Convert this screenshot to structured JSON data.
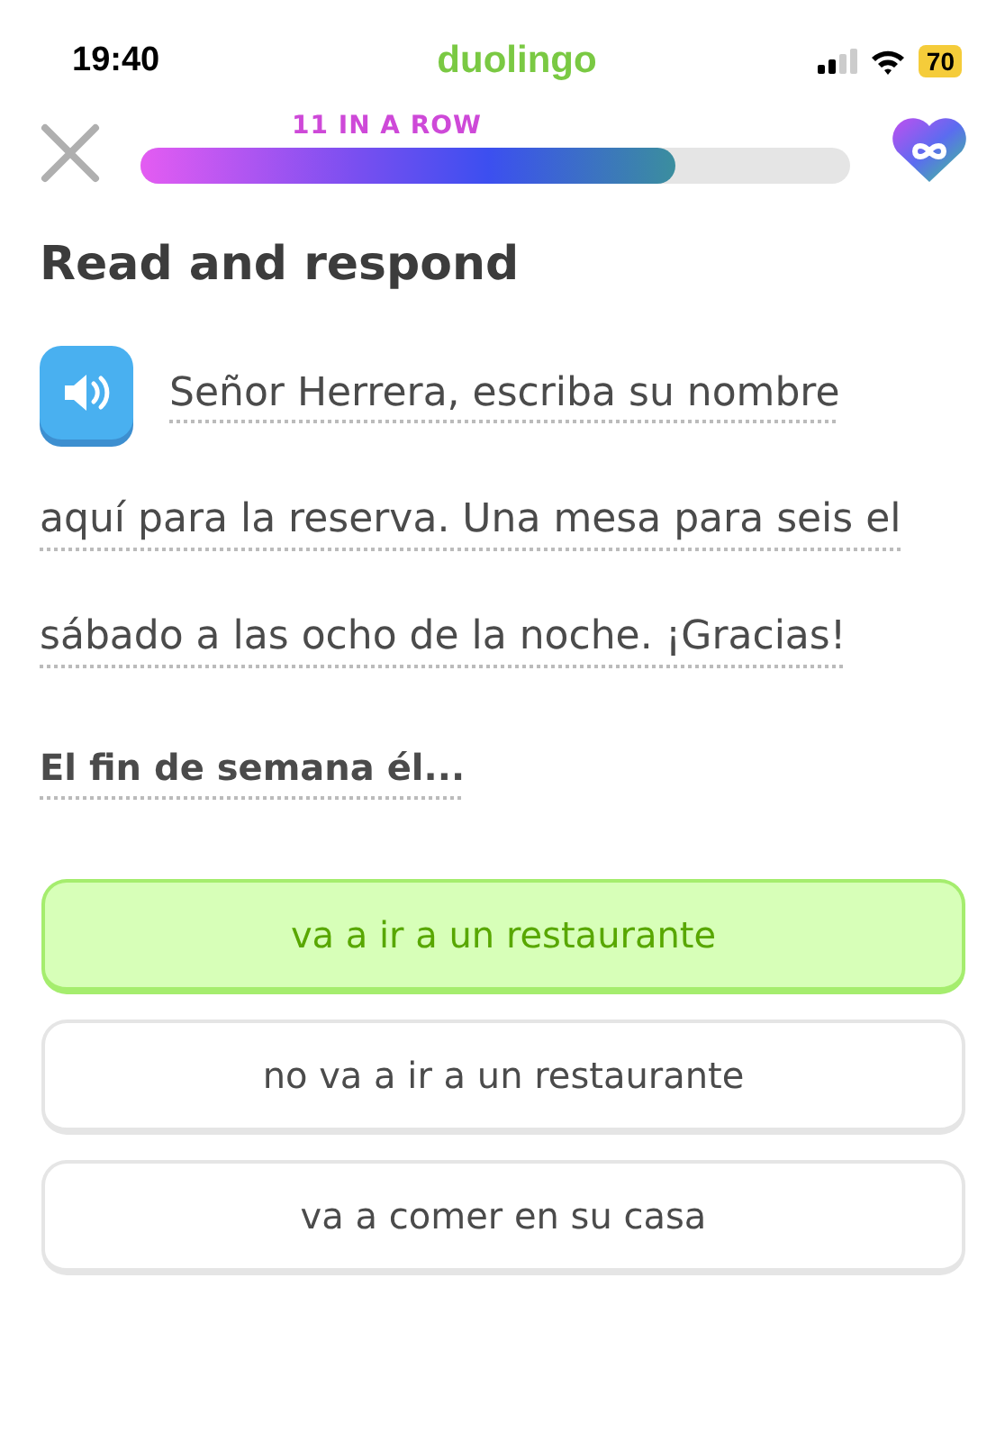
{
  "status_bar": {
    "time": "19:40",
    "app": "duolingo",
    "battery": "70"
  },
  "progress": {
    "streak": "11 IN A ROW",
    "level": 0.755
  },
  "title": "Read and respond",
  "passage_lines": [
    "Señor Herrera, escriba su nombre",
    "aquí para la reserva. Una mesa para seis el",
    "sábado a las ocho de la noche. ¡Gracias!"
  ],
  "question": "El fin de semana él...",
  "options": [
    {
      "label": "va a ir a un restaurante",
      "selected": true
    },
    {
      "label": "no va a ir a un restaurante",
      "selected": false
    },
    {
      "label": "va a comer en su casa",
      "selected": false
    }
  ]
}
